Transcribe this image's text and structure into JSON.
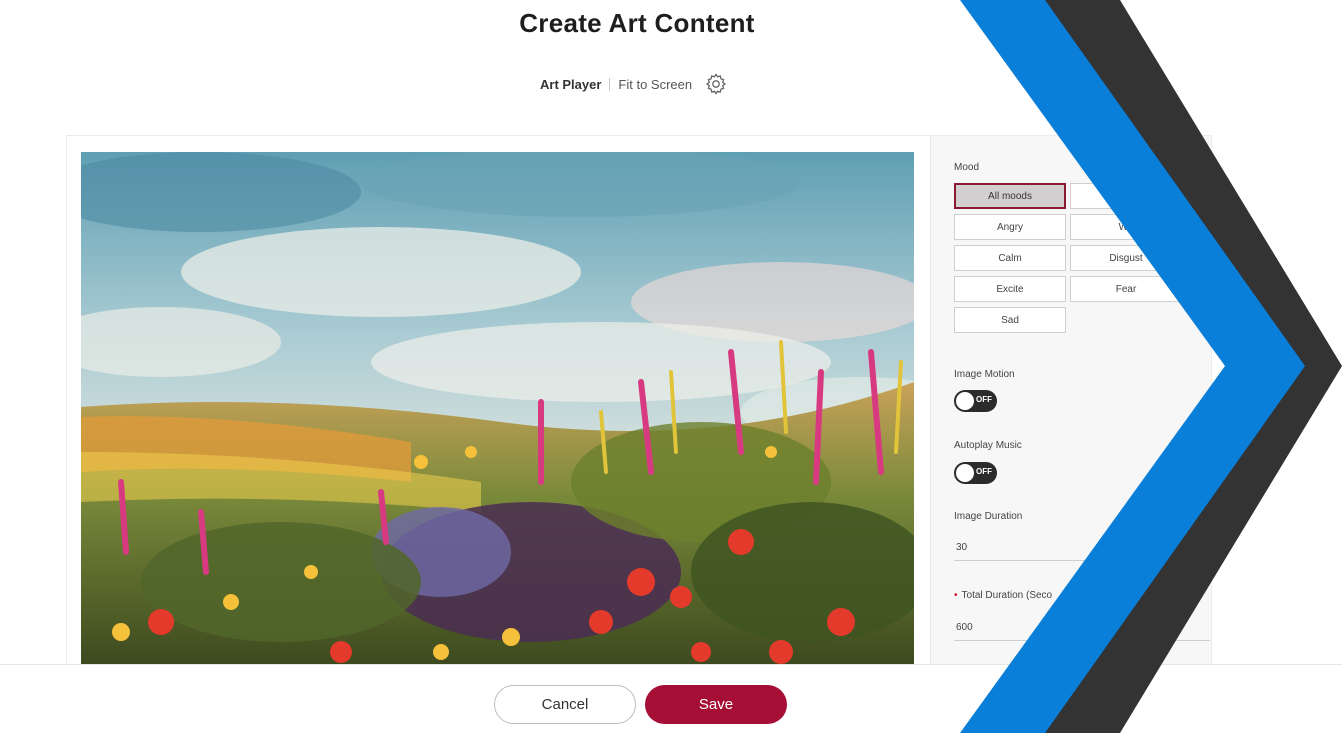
{
  "header": {
    "title": "Create Art Content"
  },
  "subbar": {
    "player": "Art Player",
    "fit": "Fit to Screen"
  },
  "settings": {
    "mood_label": "Mood",
    "moods": [
      "All moods",
      "",
      "Angry",
      "Wo",
      "Calm",
      "Disgust",
      "Excite",
      "Fear",
      "Sad"
    ],
    "selected_mood": "All moods",
    "image_motion_label": "Image Motion",
    "image_motion_state": "OFF",
    "autoplay_label": "Autoplay Music",
    "autoplay_state": "OFF",
    "image_duration_label": "Image Duration",
    "image_duration_value": "30",
    "total_duration_label": "Total Duration (Seco",
    "total_duration_value": "600"
  },
  "footer": {
    "cancel": "Cancel",
    "save": "Save"
  },
  "colors": {
    "accent": "#a50f35",
    "chevron_blue": "#0a7fd9",
    "chevron_dark": "#333333",
    "toggle_off": "#2b2b2b"
  }
}
